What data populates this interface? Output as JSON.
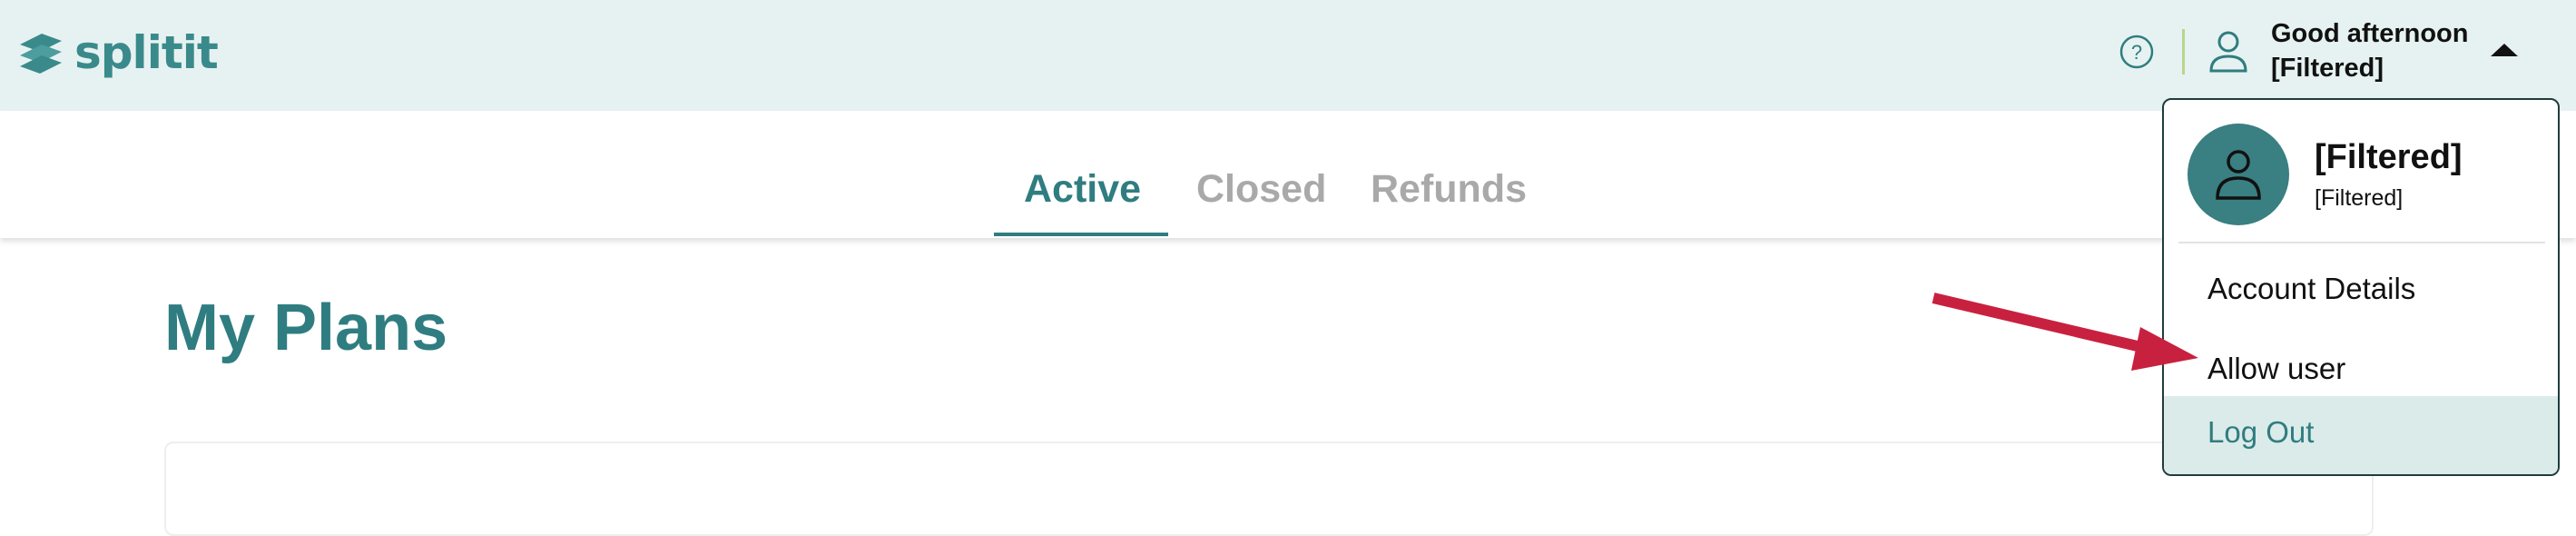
{
  "brand": {
    "name": "splitit",
    "color": "#3a8a8c"
  },
  "header": {
    "greeting": "Good afternoon",
    "user_name": "[Filtered]",
    "icons": [
      "help-icon",
      "user-icon",
      "caret-up-icon"
    ]
  },
  "tabs": [
    {
      "label": "Active",
      "active": true
    },
    {
      "label": "Closed",
      "active": false
    },
    {
      "label": "Refunds",
      "active": false
    }
  ],
  "page": {
    "title": "My Plans"
  },
  "dropdown": {
    "name": "[Filtered]",
    "email": "[Filtered]",
    "items": [
      {
        "label": "Account Details"
      },
      {
        "label": "Allow user"
      },
      {
        "label": "Log Out"
      }
    ]
  },
  "colors": {
    "accent": "#2f7d80",
    "header_bg": "#e6f2f1",
    "annotation_arrow": "#c8213f"
  }
}
